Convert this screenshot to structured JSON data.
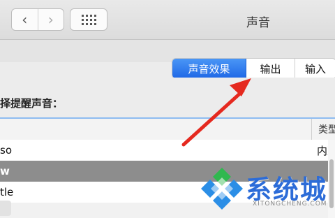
{
  "window": {
    "title": "声音"
  },
  "toolbar": {
    "back_icon": "‹",
    "forward_icon": "›",
    "grid_icon": "show-all-grid"
  },
  "tabs": [
    {
      "label": "声音效果",
      "active": true
    },
    {
      "label": "输出",
      "active": false
    },
    {
      "label": "输入",
      "active": false
    }
  ],
  "section": {
    "label": "择提醒声音："
  },
  "table": {
    "header_left": "",
    "header_right": "类型",
    "rows": [
      {
        "name": "so",
        "type": "内建"
      },
      {
        "name": "w",
        "type": ""
      },
      {
        "name": "tle",
        "type": ""
      },
      {
        "name": "",
        "type": ""
      }
    ]
  },
  "watermark": {
    "brand": "系统城",
    "domain": "XITONGCHENG.COM"
  },
  "colors": {
    "accent_blue": "#1f68e6",
    "arrow_red": "#e5291f",
    "watermark_blue": "#2c6cd8"
  }
}
